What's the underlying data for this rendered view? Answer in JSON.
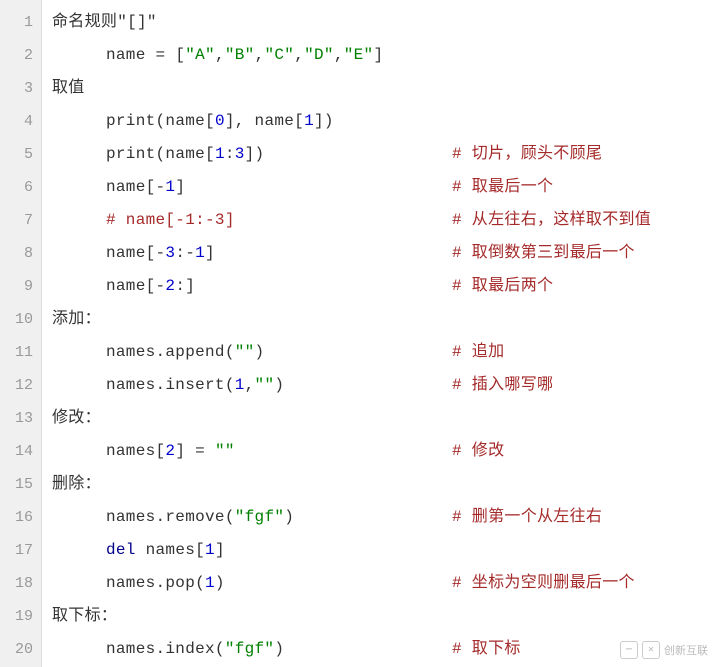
{
  "lines": [
    {
      "num": "1",
      "indent": 0,
      "tokens": [
        {
          "cls": "tok-default",
          "text": "命名规则\"[]\""
        }
      ]
    },
    {
      "num": "2",
      "indent": 1,
      "tokens": [
        {
          "cls": "tok-default",
          "text": "name "
        },
        {
          "cls": "tok-eq",
          "text": "= "
        },
        {
          "cls": "tok-bracket",
          "text": "["
        },
        {
          "cls": "tok-string",
          "text": "\"A\""
        },
        {
          "cls": "tok-default",
          "text": ","
        },
        {
          "cls": "tok-string",
          "text": "\"B\""
        },
        {
          "cls": "tok-default",
          "text": ","
        },
        {
          "cls": "tok-string",
          "text": "\"C\""
        },
        {
          "cls": "tok-default",
          "text": ","
        },
        {
          "cls": "tok-string",
          "text": "\"D\""
        },
        {
          "cls": "tok-default",
          "text": ","
        },
        {
          "cls": "tok-string",
          "text": "\"E\""
        },
        {
          "cls": "tok-bracket",
          "text": "]"
        }
      ]
    },
    {
      "num": "3",
      "indent": 0,
      "tokens": [
        {
          "cls": "tok-default",
          "text": "取值"
        }
      ]
    },
    {
      "num": "4",
      "indent": 1,
      "tokens": [
        {
          "cls": "tok-builtin",
          "text": "print"
        },
        {
          "cls": "tok-default",
          "text": "(name["
        },
        {
          "cls": "tok-number",
          "text": "0"
        },
        {
          "cls": "tok-default",
          "text": "], name["
        },
        {
          "cls": "tok-number",
          "text": "1"
        },
        {
          "cls": "tok-default",
          "text": "])"
        }
      ]
    },
    {
      "num": "5",
      "indent": 1,
      "tokens": [
        {
          "cls": "tok-builtin",
          "text": "print"
        },
        {
          "cls": "tok-default",
          "text": "(name["
        },
        {
          "cls": "tok-number",
          "text": "1"
        },
        {
          "cls": "tok-default",
          "text": ":"
        },
        {
          "cls": "tok-number",
          "text": "3"
        },
        {
          "cls": "tok-default",
          "text": "])"
        }
      ],
      "comment": "# 切片，顾头不顾尾"
    },
    {
      "num": "6",
      "indent": 1,
      "tokens": [
        {
          "cls": "tok-default",
          "text": "name["
        },
        {
          "cls": "tok-default",
          "text": "-"
        },
        {
          "cls": "tok-number",
          "text": "1"
        },
        {
          "cls": "tok-default",
          "text": "]"
        }
      ],
      "comment": "# 取最后一个"
    },
    {
      "num": "7",
      "indent": 1,
      "tokens": [
        {
          "cls": "tok-comment",
          "text": "# name[-1:-3]"
        }
      ],
      "comment": "# 从左往右，这样取不到值"
    },
    {
      "num": "8",
      "indent": 1,
      "tokens": [
        {
          "cls": "tok-default",
          "text": "name["
        },
        {
          "cls": "tok-default",
          "text": "-"
        },
        {
          "cls": "tok-number",
          "text": "3"
        },
        {
          "cls": "tok-default",
          "text": ":-"
        },
        {
          "cls": "tok-number",
          "text": "1"
        },
        {
          "cls": "tok-default",
          "text": "]"
        }
      ],
      "comment": "# 取倒数第三到最后一个"
    },
    {
      "num": "9",
      "indent": 1,
      "tokens": [
        {
          "cls": "tok-default",
          "text": "name["
        },
        {
          "cls": "tok-default",
          "text": "-"
        },
        {
          "cls": "tok-number",
          "text": "2"
        },
        {
          "cls": "tok-default",
          "text": ":]"
        }
      ],
      "comment": "# 取最后两个"
    },
    {
      "num": "10",
      "indent": 0,
      "tokens": [
        {
          "cls": "tok-default",
          "text": "添加："
        }
      ]
    },
    {
      "num": "11",
      "indent": 1,
      "tokens": [
        {
          "cls": "tok-default",
          "text": "names.append("
        },
        {
          "cls": "tok-string",
          "text": "\"\""
        },
        {
          "cls": "tok-default",
          "text": ")"
        }
      ],
      "comment": "# 追加"
    },
    {
      "num": "12",
      "indent": 1,
      "tokens": [
        {
          "cls": "tok-default",
          "text": "names.insert("
        },
        {
          "cls": "tok-number",
          "text": "1"
        },
        {
          "cls": "tok-default",
          "text": ","
        },
        {
          "cls": "tok-string",
          "text": "\"\""
        },
        {
          "cls": "tok-default",
          "text": ")"
        }
      ],
      "comment": "# 插入哪写哪"
    },
    {
      "num": "13",
      "indent": 0,
      "tokens": [
        {
          "cls": "tok-default",
          "text": "修改："
        }
      ]
    },
    {
      "num": "14",
      "indent": 1,
      "tokens": [
        {
          "cls": "tok-default",
          "text": "names["
        },
        {
          "cls": "tok-number",
          "text": "2"
        },
        {
          "cls": "tok-default",
          "text": "] = "
        },
        {
          "cls": "tok-string",
          "text": "\"\""
        }
      ],
      "comment": "# 修改"
    },
    {
      "num": "15",
      "indent": 0,
      "tokens": [
        {
          "cls": "tok-default",
          "text": "删除："
        }
      ]
    },
    {
      "num": "16",
      "indent": 1,
      "tokens": [
        {
          "cls": "tok-default",
          "text": "names.remove("
        },
        {
          "cls": "tok-string",
          "text": "\"fgf\""
        },
        {
          "cls": "tok-default",
          "text": ")"
        }
      ],
      "comment": "# 删第一个从左往右"
    },
    {
      "num": "17",
      "indent": 1,
      "tokens": [
        {
          "cls": "tok-keyword",
          "text": "del"
        },
        {
          "cls": "tok-default",
          "text": " names["
        },
        {
          "cls": "tok-number",
          "text": "1"
        },
        {
          "cls": "tok-default",
          "text": "]"
        }
      ]
    },
    {
      "num": "18",
      "indent": 1,
      "tokens": [
        {
          "cls": "tok-default",
          "text": "names.pop("
        },
        {
          "cls": "tok-number",
          "text": "1"
        },
        {
          "cls": "tok-default",
          "text": ")"
        }
      ],
      "comment": "# 坐标为空则删最后一个"
    },
    {
      "num": "19",
      "indent": 0,
      "tokens": [
        {
          "cls": "tok-default",
          "text": "取下标："
        }
      ]
    },
    {
      "num": "20",
      "indent": 1,
      "tokens": [
        {
          "cls": "tok-default",
          "text": "names.index("
        },
        {
          "cls": "tok-string",
          "text": "\"fgf\""
        },
        {
          "cls": "tok-default",
          "text": ")"
        }
      ],
      "comment": "# 取下标"
    }
  ],
  "watermark": {
    "brand": "创新互联"
  }
}
